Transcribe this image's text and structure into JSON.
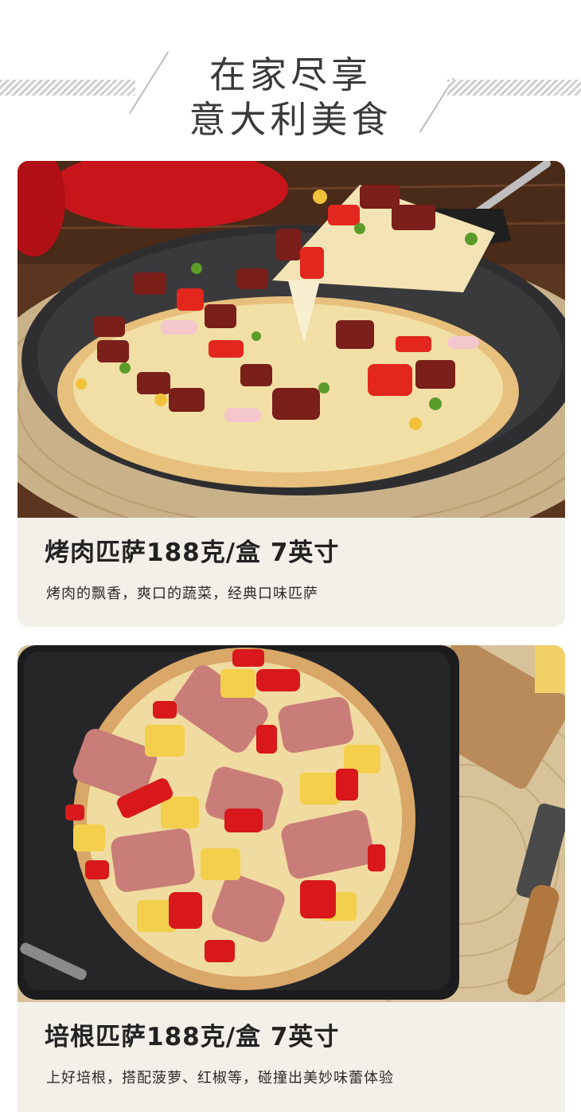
{
  "header": {
    "title_line1": "在家尽享",
    "title_line2": "意大利美食"
  },
  "products": [
    {
      "name": "烤肉匹萨188克/盒 7英寸",
      "description": "烤肉的飘香，爽口的蔬菜，经典口味匹萨",
      "image_icon": "bbq-pizza-photo"
    },
    {
      "name": "培根匹萨188克/盒 7英寸",
      "description": "上好培根，搭配菠萝、红椒等，碰撞出美妙味蕾体验",
      "image_icon": "bacon-pizza-photo"
    }
  ],
  "colors": {
    "card_background": "#f3efe9",
    "title_text": "#3a3a3a",
    "product_text": "#222222"
  }
}
